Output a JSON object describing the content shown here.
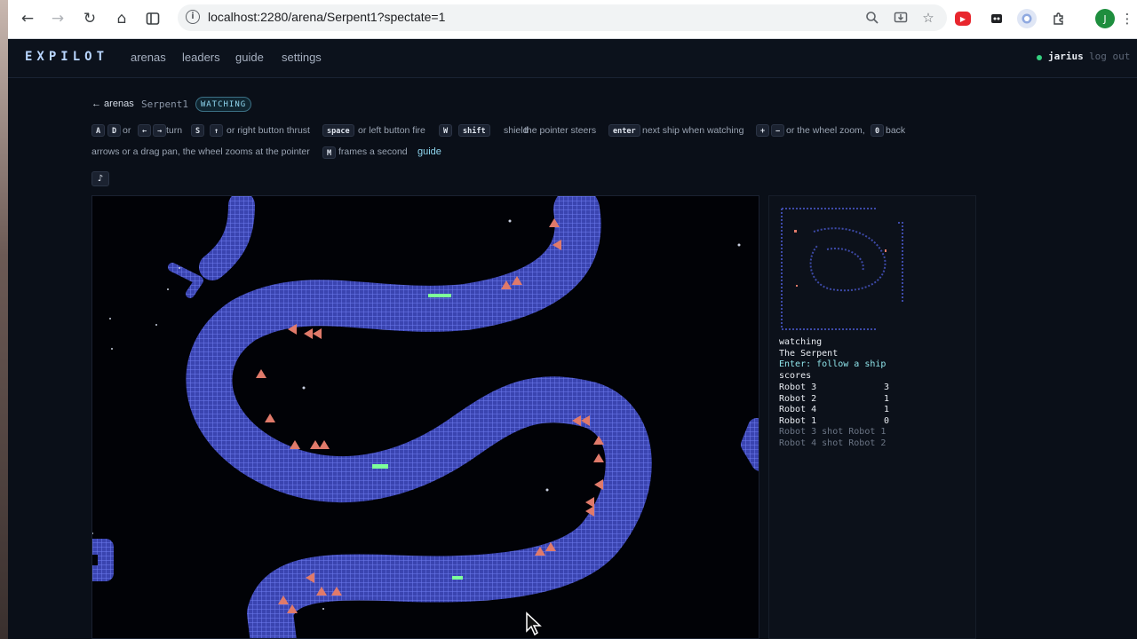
{
  "browser": {
    "url": "localhost:2280/arena/Serpent1?spectate=1",
    "profile_initial": "J"
  },
  "nav": {
    "logo": "EXPILOT",
    "links": [
      "arenas",
      "leaders",
      "guide",
      "settings"
    ],
    "username": "jarius",
    "logout": "log out"
  },
  "crumbs": {
    "back": "← arenas",
    "arena": "Serpent1",
    "badge": "WATCHING"
  },
  "controls": {
    "row1": [
      {
        "key": "A"
      },
      {
        "key": "D"
      },
      {
        "text": "or"
      },
      {
        "key": "←"
      },
      {
        "key": "→"
      },
      {
        "text": "turn"
      },
      {
        "key": "S"
      },
      {
        "key": "↑"
      },
      {
        "text": "or right button thrust"
      },
      {
        "key": "space"
      },
      {
        "text": "or left button fire"
      },
      {
        "key": "W"
      },
      {
        "key": "shift"
      },
      {
        "text": "shield"
      },
      {
        "text": "the pointer steers"
      },
      {
        "key": "enter"
      },
      {
        "text": "next ship when watching"
      },
      {
        "key": "+"
      },
      {
        "key": "−"
      },
      {
        "text": "or the wheel zoom,"
      },
      {
        "key": "0"
      },
      {
        "text": "back"
      }
    ],
    "row2_text": "arrows or a drag pan, the wheel zooms at the pointer",
    "row2_key": "M",
    "row2_after": "frames a second",
    "guide_link": "guide",
    "music_button": "♪"
  },
  "side": {
    "status": "watching",
    "map_name": "The Serpent",
    "hint": "Enter: follow a ship",
    "scores_label": "scores",
    "scores": [
      {
        "name": "Robot 3",
        "score": "3"
      },
      {
        "name": "Robot 2",
        "score": "1"
      },
      {
        "name": "Robot 4",
        "score": "1"
      },
      {
        "name": "Robot 1",
        "score": "0"
      }
    ],
    "events": [
      "Robot 3 shot Robot 1",
      "Robot 4 shot Robot 2"
    ]
  },
  "colors": {
    "wall": "#4a55c8",
    "accent": "#8fd6ef",
    "cannon": "#e07a6a",
    "ship": "#7dff9a"
  }
}
